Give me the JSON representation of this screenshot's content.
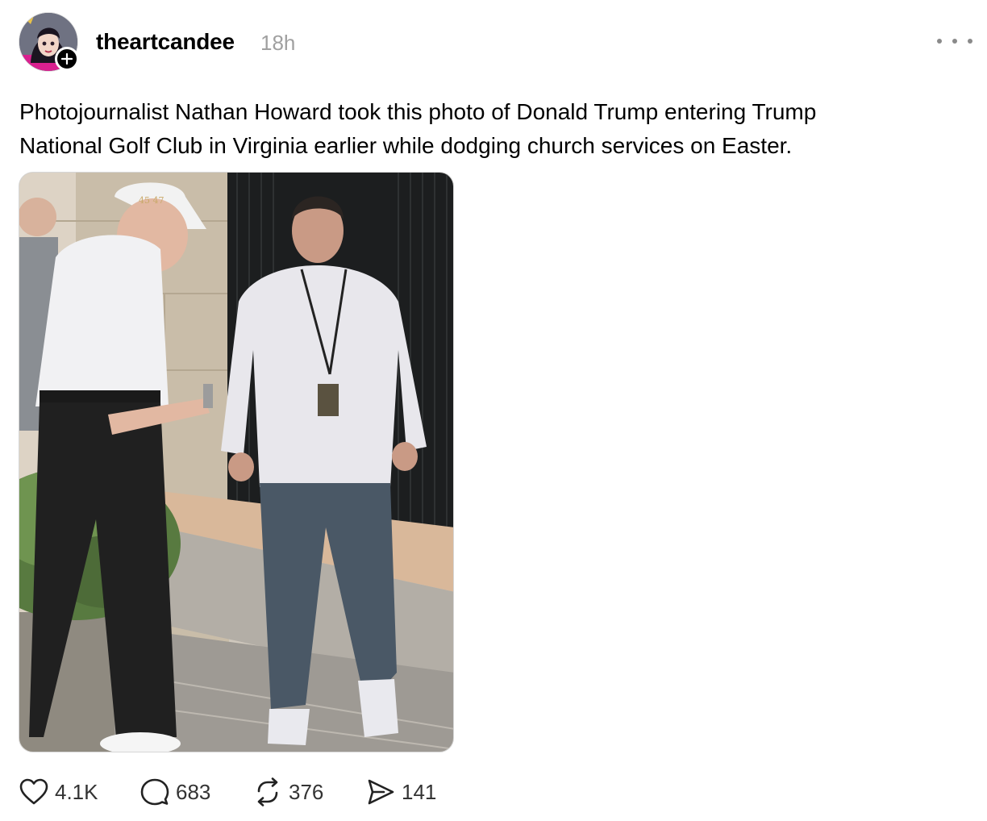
{
  "post": {
    "author": "theartcandee",
    "time": "18h",
    "text_line1": "Photojournalist Nathan Howard took this photo of Donald Trump entering Trump",
    "text_line2": "National Golf Club in Virginia earlier while dodging church services on Easter.",
    "image_cap_text": "45 47"
  },
  "actions": {
    "likes": "4.1K",
    "replies": "683",
    "reposts": "376",
    "shares": "141"
  },
  "icons": {
    "more": "more-dots-icon",
    "follow": "plus-icon",
    "like": "heart-icon",
    "reply": "comment-icon",
    "repost": "repost-icon",
    "share": "send-icon"
  }
}
